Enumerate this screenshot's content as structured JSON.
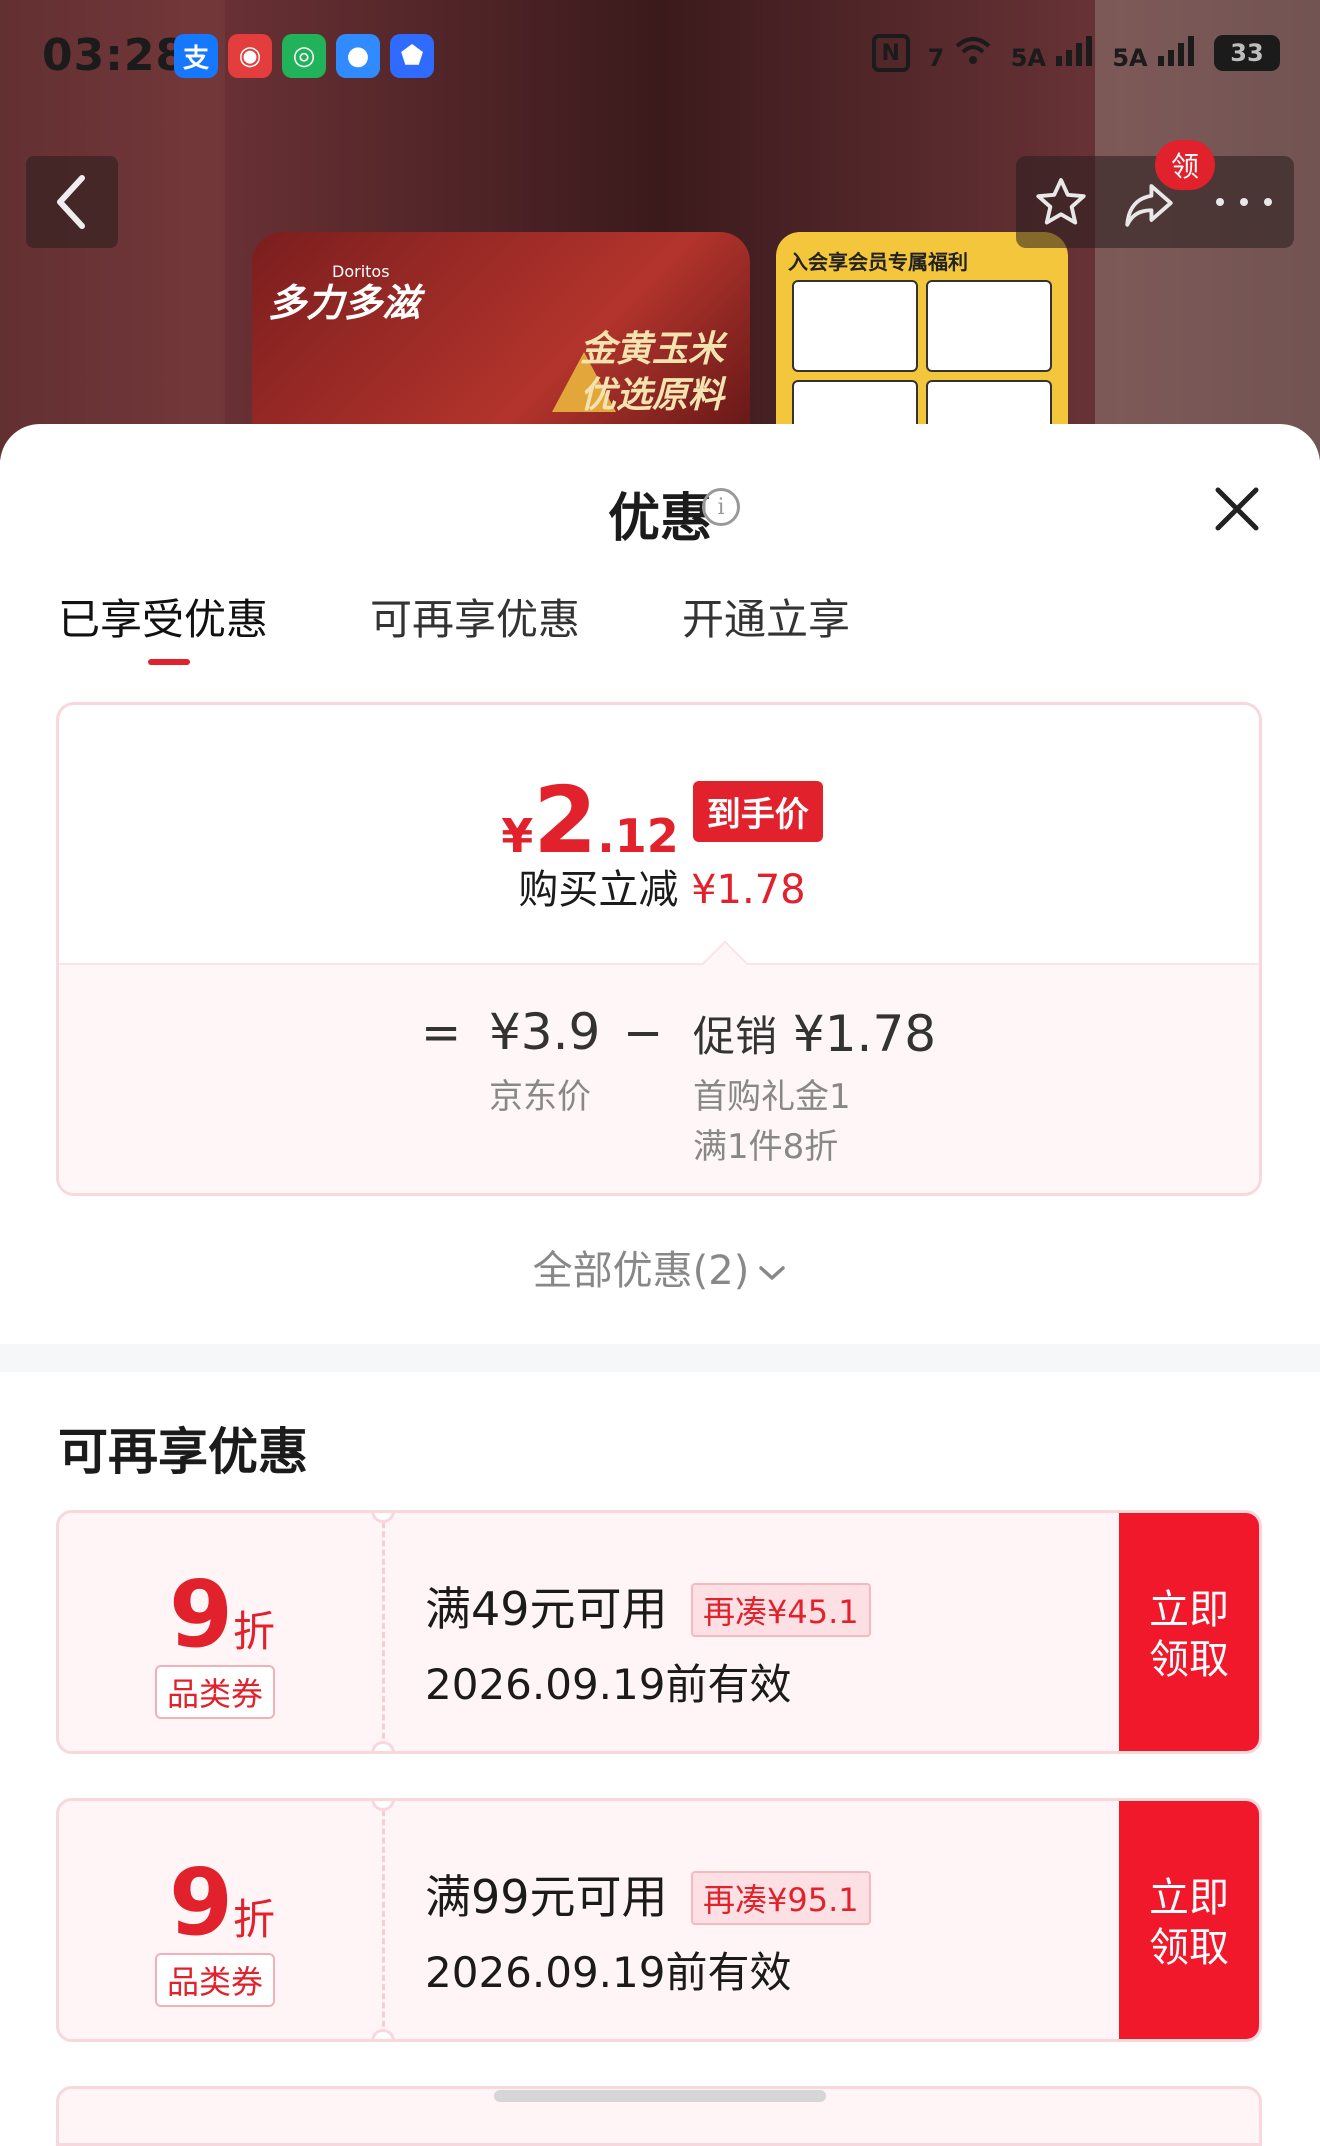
{
  "status_bar": {
    "time": "03:28",
    "apps": [
      {
        "name": "alipay-icon",
        "glyph": "支",
        "color": "#1677ff"
      },
      {
        "name": "app-red-icon",
        "glyph": "◉",
        "color": "#e43d3d"
      },
      {
        "name": "app-green-icon",
        "glyph": "◎",
        "color": "#21b35a"
      },
      {
        "name": "messages-icon",
        "glyph": "●",
        "color": "#2f8bff"
      },
      {
        "name": "shield-app-icon",
        "glyph": "⬟",
        "color": "#2f6bff"
      }
    ],
    "signal1": "7",
    "signal2": "5A",
    "signal3": "5A",
    "battery": "33"
  },
  "header": {
    "ling_badge": "领",
    "banner": {
      "brand": "Doritos",
      "logo": "多力多滋",
      "slogan1": "金黄玉米",
      "slogan2": "优选原料",
      "side_title": "入会享会员专属福利"
    }
  },
  "sheet": {
    "title": "优惠",
    "tabs": [
      {
        "label": "已享受优惠",
        "active": true
      },
      {
        "label": "可再享优惠",
        "active": false
      },
      {
        "label": "开通立享",
        "active": false
      }
    ],
    "price": {
      "yen": "¥",
      "integer": "2",
      "decimal": ".12",
      "tag": "到手价",
      "reduce_label": "购买立减",
      "reduce_amount": "¥1.78"
    },
    "calc": {
      "equals": "=",
      "jd_price": "¥3.9",
      "jd_price_label": "京东价",
      "minus": "−",
      "promo_label": "促销",
      "promo_amount": "¥1.78",
      "promo_detail1": "首购礼金1",
      "promo_detail2": "满1件8折"
    },
    "all_offers": "全部优惠(2)",
    "section_title": "可再享优惠",
    "coupons": [
      {
        "num": "9",
        "unit": "折",
        "type": "品类券",
        "condition": "满49元可用",
        "gap": "再凑¥45.1",
        "date": "2026.09.19前有效",
        "claim1": "立即",
        "claim2": "领取"
      },
      {
        "num": "9",
        "unit": "折",
        "type": "品类券",
        "condition": "满99元可用",
        "gap": "再凑¥95.1",
        "date": "2026.09.19前有效",
        "claim1": "立即",
        "claim2": "领取"
      }
    ]
  },
  "colors": {
    "accent": "#e1222c",
    "claim_button": "#f0182a",
    "coupon_bg": "#fff5f6"
  }
}
